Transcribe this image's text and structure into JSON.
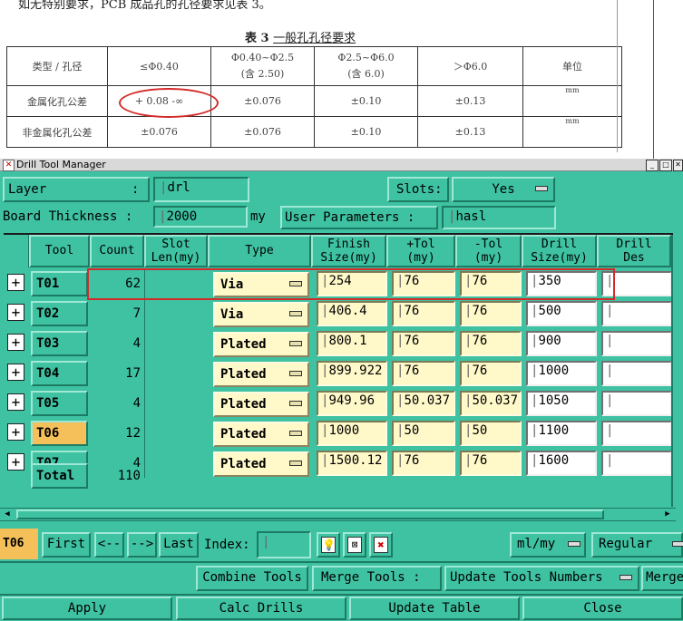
{
  "doc": {
    "intro": "如无特别要求，PCB 成品孔的孔径要求见表 3。",
    "caption_no": "表 3",
    "caption_title": "一般孔孔径要求",
    "table": {
      "header": [
        "类型 / 孔径",
        "≤Φ0.40",
        "Φ0.40~Φ2.5\n(含 2.50)",
        "Φ2.5~Φ6.0\n(含 6.0)",
        "＞Φ6.0",
        "单位"
      ],
      "rows": [
        [
          "金属化孔公差",
          "+ 0.08  -∞",
          "±0.076",
          "±0.10",
          "±0.13",
          "mm"
        ],
        [
          "非金属化孔公差",
          "±0.076",
          "±0.076",
          "±0.10",
          "±0.13",
          "mm"
        ]
      ]
    }
  },
  "window": {
    "title": "Drill Tool Manager",
    "layer_label": "Layer",
    "layer_colon": ":",
    "layer_value": "drl",
    "slots_label": "Slots:",
    "slots_value": "Yes",
    "board_thickness_label": "Board Thickness :",
    "board_thickness_value": "2000",
    "board_thickness_unit": "my",
    "user_params_label": "User Parameters :",
    "user_params_value": "hasl"
  },
  "table": {
    "columns": [
      "Tool",
      "Count",
      "Slot\nLen(my)",
      "Type",
      "Finish\nSize(my)",
      "+Tol\n(my)",
      "-Tol\n(my)",
      "Drill\nSize(my)",
      "Drill\nDes"
    ],
    "rows": [
      {
        "tool": "T01",
        "count": "62",
        "type": "Via",
        "finish": "254",
        "ptol": "76",
        "ntol": "76",
        "drill": "350",
        "des": ""
      },
      {
        "tool": "T02",
        "count": "7",
        "type": "Via",
        "finish": "406.4",
        "ptol": "76",
        "ntol": "76",
        "drill": "500",
        "des": ""
      },
      {
        "tool": "T03",
        "count": "4",
        "type": "Plated",
        "finish": "800.1",
        "ptol": "76",
        "ntol": "76",
        "drill": "900",
        "des": ""
      },
      {
        "tool": "T04",
        "count": "17",
        "type": "Plated",
        "finish": "899.922",
        "ptol": "76",
        "ntol": "76",
        "drill": "1000",
        "des": ""
      },
      {
        "tool": "T05",
        "count": "4",
        "type": "Plated",
        "finish": "949.96",
        "ptol": "50.037",
        "ntol": "50.037",
        "drill": "1050",
        "des": ""
      },
      {
        "tool": "T06",
        "count": "12",
        "type": "Plated",
        "finish": "1000",
        "ptol": "50",
        "ntol": "50",
        "drill": "1100",
        "des": ""
      },
      {
        "tool": "T07",
        "count": "4",
        "type": "Plated",
        "finish": "1500.12",
        "ptol": "76",
        "ntol": "76",
        "drill": "1600",
        "des": ""
      }
    ],
    "selected_tool": "T06",
    "total_label": "Total",
    "total_count": "110"
  },
  "nav": {
    "current": "T06",
    "first": "First",
    "prev": "<--",
    "next": "-->",
    "last": "Last",
    "index_label": "Index:",
    "units": "ml/my",
    "mode": "Regular"
  },
  "tools_bar": {
    "combine": "Combine Tools",
    "merge": "Merge Tools :",
    "update_numbers": "Update Tools Numbers",
    "merge2": "Merge"
  },
  "bottom": {
    "apply": "Apply",
    "calc": "Calc Drills",
    "update_table": "Update Table",
    "close": "Close"
  },
  "colors": {
    "panel": "#3ec2a2",
    "field_yellow": "#fff8c8",
    "highlight_red": "#d42a2a",
    "selected_tool": "#f5c05a"
  }
}
